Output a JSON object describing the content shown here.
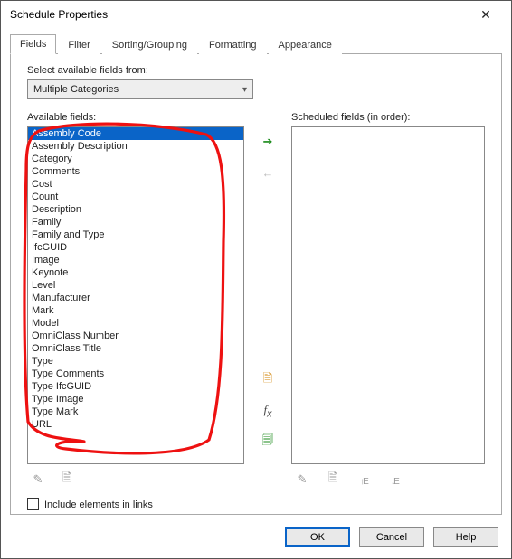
{
  "titlebar": {
    "title": "Schedule Properties"
  },
  "tabs": [
    {
      "label": "Fields",
      "active": true
    },
    {
      "label": "Filter"
    },
    {
      "label": "Sorting/Grouping"
    },
    {
      "label": "Formatting"
    },
    {
      "label": "Appearance"
    }
  ],
  "labels": {
    "select_from": "Select available fields from:",
    "available": "Available fields:",
    "scheduled": "Scheduled fields (in order):",
    "include_links": "Include elements in links"
  },
  "combo": {
    "value": "Multiple Categories"
  },
  "available_fields": [
    "Assembly Code",
    "Assembly Description",
    "Category",
    "Comments",
    "Cost",
    "Count",
    "Description",
    "Family",
    "Family and Type",
    "IfcGUID",
    "Image",
    "Keynote",
    "Level",
    "Manufacturer",
    "Mark",
    "Model",
    "OmniClass Number",
    "OmniClass Title",
    "Type",
    "Type Comments",
    "Type IfcGUID",
    "Type Image",
    "Type Mark",
    "URL"
  ],
  "selected_index": 0,
  "scheduled_fields": [],
  "icons": {
    "add": "add-field",
    "remove": "remove-field",
    "new_param": "new-parameter",
    "fx": "calculated-value",
    "combine": "combine-parameters",
    "edit": "edit",
    "newf": "new",
    "up": "move-up",
    "down": "move-down"
  },
  "buttons": {
    "ok": "OK",
    "cancel": "Cancel",
    "help": "Help"
  }
}
